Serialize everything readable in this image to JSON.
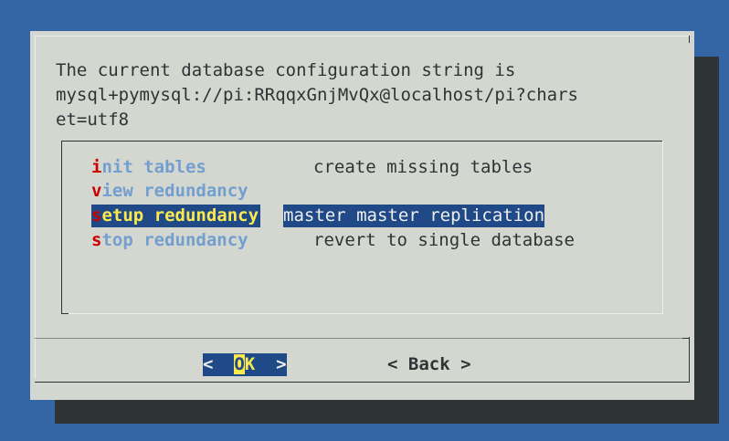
{
  "dialog": {
    "prompt_lines": [
      "The current database configuration string is",
      "mysql+pymysql://pi:RRqqxGnjMvQx@localhost/pi?chars",
      "et=utf8"
    ]
  },
  "menu": {
    "items": [
      {
        "hot": "i",
        "rest": "nit tables",
        "desc": "create missing tables",
        "selected": false
      },
      {
        "hot": "v",
        "rest": "iew redundancy",
        "desc": "",
        "selected": false
      },
      {
        "hot": "s",
        "rest": "etup redundancy",
        "desc": "master master replication",
        "selected": true
      },
      {
        "hot": "s",
        "rest": "top redundancy",
        "desc": "revert to single database",
        "selected": false
      }
    ]
  },
  "buttons": {
    "ok": {
      "left": "<  ",
      "hot": "O",
      "rest": "K",
      "right": "  >"
    },
    "back": "< Back >"
  },
  "colors": {
    "background": "#3465a4",
    "dialog": "#d3d7cf",
    "selection": "#204a87",
    "highlight": "#fce94f",
    "hotkey": "#cc0000",
    "tag": "#729fcf"
  }
}
